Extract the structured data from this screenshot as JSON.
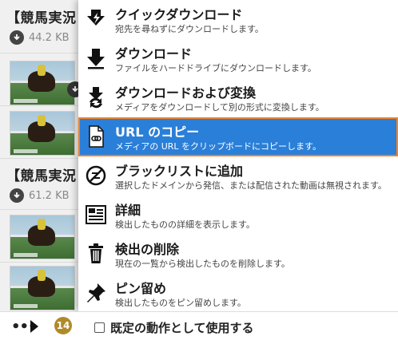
{
  "list": {
    "groups": [
      {
        "title": "【競馬実況",
        "size": "44.2 KB"
      },
      {
        "title": "【競馬実況",
        "size": "61.2 KB"
      }
    ]
  },
  "menu": {
    "items": [
      {
        "title": "クイックダウンロード",
        "desc": "宛先を尋ねずにダウンロードします。",
        "icon": "quick-download-icon"
      },
      {
        "title": "ダウンロード",
        "desc": "ファイルをハードドライブにダウンロードします。",
        "icon": "download-icon"
      },
      {
        "title": "ダウンロードおよび変換",
        "desc": "メディアをダウンロードして別の形式に変換します。",
        "icon": "download-convert-icon"
      },
      {
        "title": "URL のコピー",
        "desc": "メディアの URL をクリップボードにコピーします。",
        "icon": "copy-url-icon"
      },
      {
        "title": "ブラックリストに追加",
        "desc": "選択したドメインから発信、または配信された動画は無視されます。",
        "icon": "blacklist-icon"
      },
      {
        "title": "詳細",
        "desc": "検出したものの詳細を表示します。",
        "icon": "details-icon"
      },
      {
        "title": "検出の削除",
        "desc": "現在の一覧から検出したものを削除します。",
        "icon": "trash-icon"
      },
      {
        "title": "ピン留め",
        "desc": "検出したものをピン留めします。",
        "icon": "pin-icon"
      }
    ]
  },
  "footer": {
    "more_label": "•••",
    "count": "14",
    "default_action_label": "既定の動作として使用する"
  },
  "colors": {
    "highlight": "#2a7fd8",
    "focus_outline": "#f0822a",
    "badge": "#b08a2a"
  }
}
